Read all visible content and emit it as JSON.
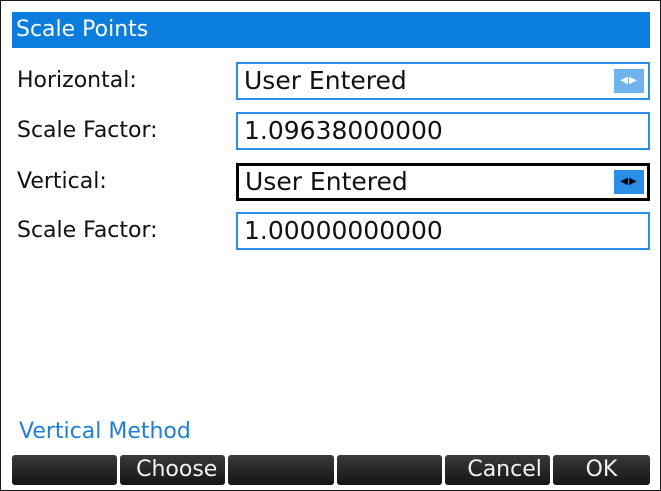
{
  "title": "Scale Points",
  "form": {
    "rows": [
      {
        "label": "Horizontal:",
        "value": "User Entered",
        "type": "choose"
      },
      {
        "label": "Scale Factor:",
        "value": "1.09638000000",
        "type": "text"
      },
      {
        "label": "Vertical:",
        "value": "User Entered",
        "type": "choose",
        "focused": true
      },
      {
        "label": "Scale Factor:",
        "value": "1.00000000000",
        "type": "text"
      }
    ]
  },
  "hint": "Vertical Method",
  "softkeys": [
    "",
    "Choose",
    "",
    "",
    "Cancel",
    "OK"
  ],
  "icons": {
    "spinner": "left-right-arrows-icon"
  },
  "colors": {
    "accent": "#0a7ddd",
    "field_border": "#2a8de6",
    "hint": "#1f7fd6"
  }
}
